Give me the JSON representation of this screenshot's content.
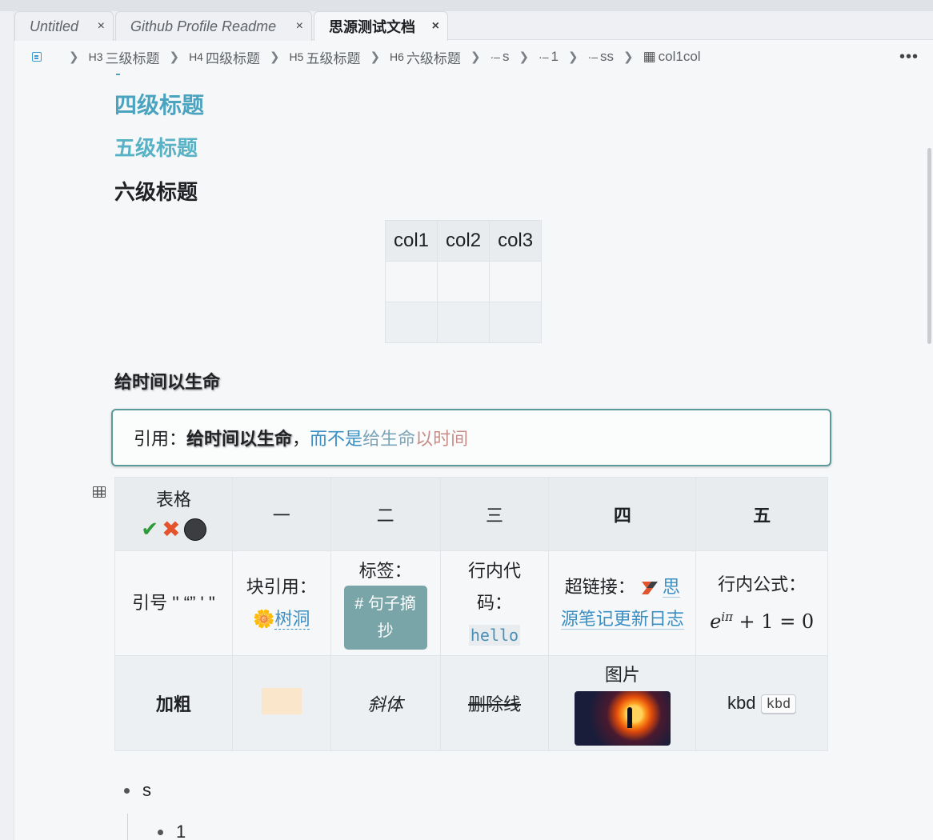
{
  "tabs": [
    {
      "title": "Untitled",
      "close": "×"
    },
    {
      "title": "Github Profile Readme",
      "close": "×"
    },
    {
      "title": "思源测试文档",
      "close": "×"
    }
  ],
  "breadcrumb": {
    "items": [
      {
        "tag": "H3",
        "label": "三级标题"
      },
      {
        "tag": "H4",
        "label": "四级标题"
      },
      {
        "tag": "H5",
        "label": "五级标题"
      },
      {
        "tag": "H6",
        "label": "六级标题"
      },
      {
        "tag": "·–",
        "label": "s"
      },
      {
        "tag": "·–",
        "label": "1"
      },
      {
        "tag": "·–",
        "label": "ss"
      },
      {
        "tag": "",
        "label": "col1col"
      }
    ],
    "more": "•••"
  },
  "headings": {
    "h4": "四级标题",
    "h5": "五级标题",
    "h6": "六级标题"
  },
  "small_table": {
    "headers": [
      "col1",
      "col2",
      "col3"
    ]
  },
  "life_heading": "给时间以生命",
  "quote": {
    "prefix": "引用：",
    "bold": "给时间以生命",
    "comma": "，",
    "blue": "而不是",
    "grad1": "给生命",
    "grad2": "以时间"
  },
  "big_table": {
    "headers": [
      "表格",
      "一",
      "二",
      "三",
      "四",
      "五"
    ],
    "header_icons": [
      "check-icon",
      "cross-icon",
      "circle-icon"
    ],
    "row2": {
      "c1": "引号 '' “” ' \"",
      "c2_label": "块引用：",
      "c2_link": "树洞",
      "c3_label": "标签：",
      "c3_tag": "# 句子摘抄",
      "c4_label": "行内代码：",
      "c4_code": "hello",
      "c5_label": "超链接：",
      "c5_link": "思源笔记更新日志",
      "c6_label": "行内公式：",
      "c6_math_base": "e",
      "c6_math_sup": "iπ",
      "c6_math_rest": " + 1 = 0"
    },
    "row3": {
      "c1": "加粗",
      "c3": "斜体",
      "c4": "删除线",
      "c5": "图片",
      "c6_text": "kbd",
      "c6_kbd": "kbd"
    },
    "colors": {
      "tag_bg": "#7aa5a8",
      "swatch": "#f9e6cb",
      "link": "#3a8fc3"
    }
  },
  "list": {
    "item1": "s",
    "item2": "1"
  }
}
